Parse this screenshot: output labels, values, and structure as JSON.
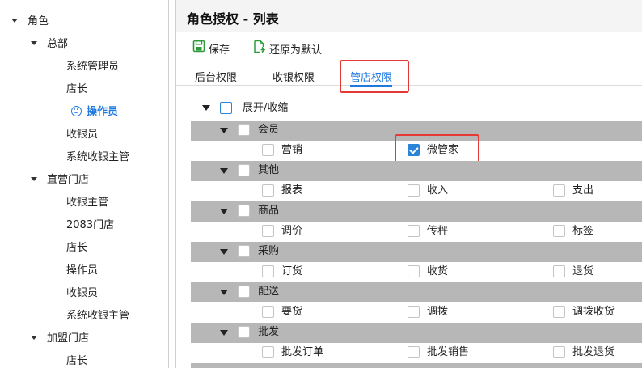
{
  "tree": {
    "root": "角色",
    "groups": [
      {
        "label": "总部",
        "children": [
          "系统管理员",
          "店长",
          "操作员",
          "收银员",
          "系统收银主管"
        ]
      },
      {
        "label": "直营门店",
        "children": [
          "收银主管",
          "2083门店",
          "店长",
          "操作员",
          "收银员",
          "系统收银主管"
        ]
      },
      {
        "label": "加盟门店",
        "children": [
          "店长"
        ]
      }
    ],
    "selected": "操作员"
  },
  "panel": {
    "title": "角色授权 - 列表",
    "toolbar": {
      "save_label": "保存",
      "reset_label": "还原为默认"
    },
    "tabs": [
      "后台权限",
      "收银权限",
      "管店权限"
    ],
    "active_tab": "管店权限"
  },
  "permissions": {
    "expand_label": "展开/收缩",
    "groups": [
      {
        "label": "会员",
        "items": [
          {
            "label": "营销",
            "checked": false
          },
          {
            "label": "微管家",
            "checked": true
          }
        ]
      },
      {
        "label": "其他",
        "items": [
          {
            "label": "报表",
            "checked": false
          },
          {
            "label": "收入",
            "checked": false
          },
          {
            "label": "支出",
            "checked": false
          }
        ]
      },
      {
        "label": "商品",
        "items": [
          {
            "label": "调价",
            "checked": false
          },
          {
            "label": "传秤",
            "checked": false
          },
          {
            "label": "标签",
            "checked": false
          }
        ]
      },
      {
        "label": "采购",
        "items": [
          {
            "label": "订货",
            "checked": false
          },
          {
            "label": "收货",
            "checked": false
          },
          {
            "label": "退货",
            "checked": false
          }
        ]
      },
      {
        "label": "配送",
        "items": [
          {
            "label": "要货",
            "checked": false
          },
          {
            "label": "调拨",
            "checked": false
          },
          {
            "label": "调拨收货",
            "checked": false
          }
        ]
      },
      {
        "label": "批发",
        "items": [
          {
            "label": "批发订单",
            "checked": false
          },
          {
            "label": "批发销售",
            "checked": false
          },
          {
            "label": "批发退货",
            "checked": false
          }
        ]
      }
    ]
  },
  "colors": {
    "accent": "#1f7ae0",
    "highlight_box": "#e53935",
    "group_row_bg": "#b7b7b7"
  }
}
